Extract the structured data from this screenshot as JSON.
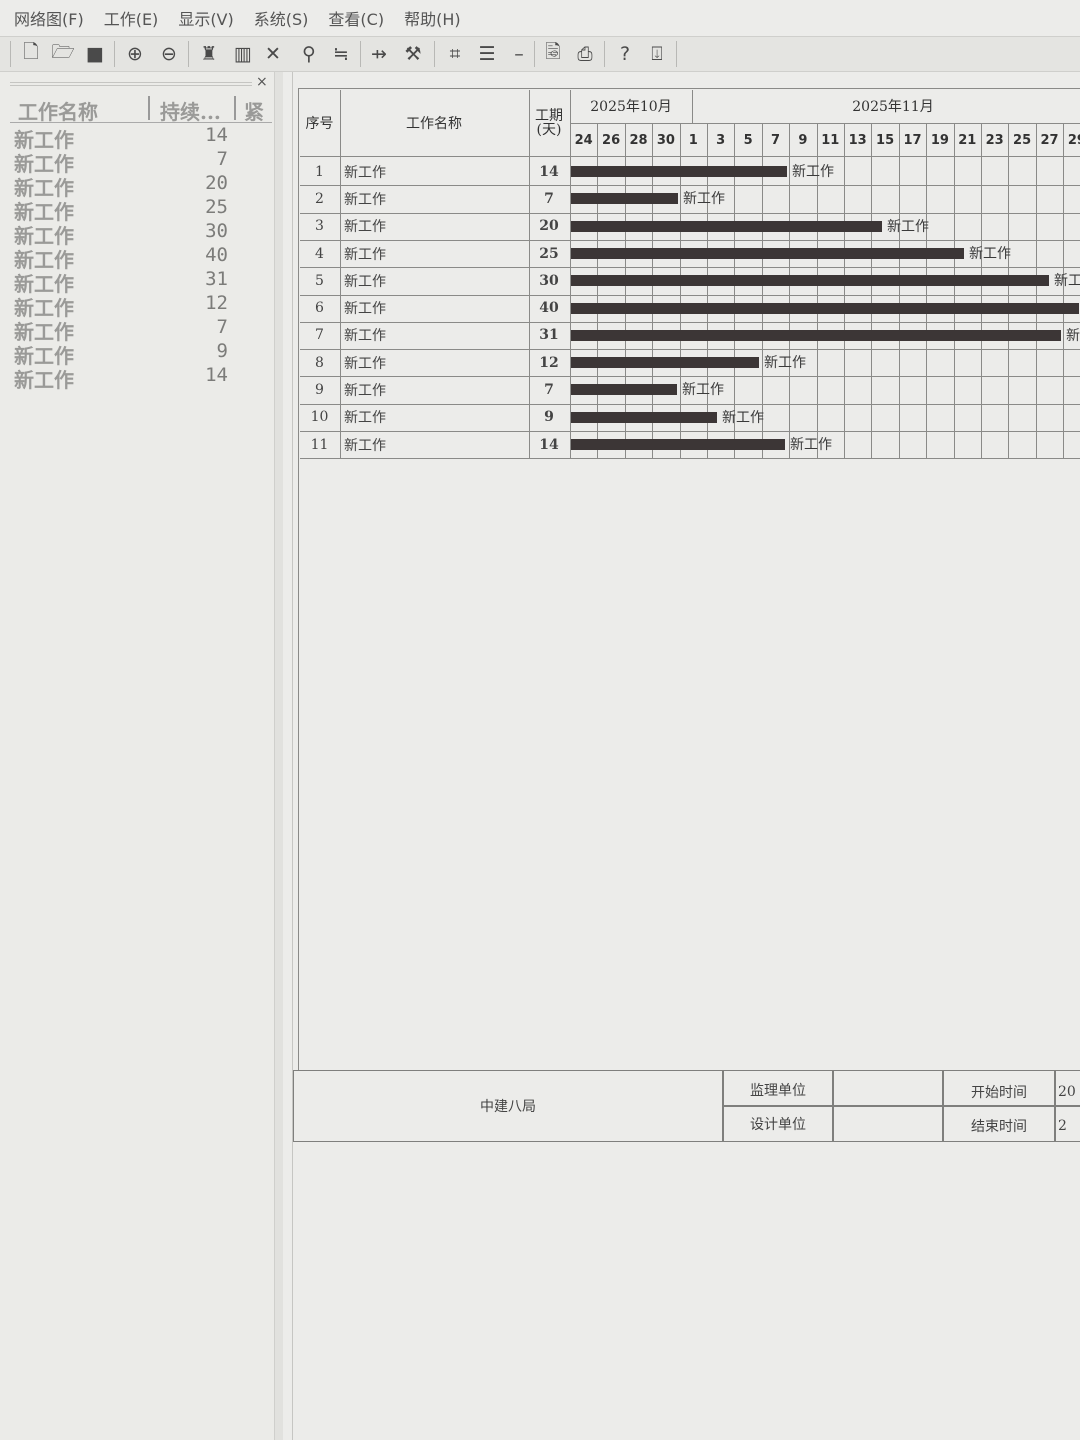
{
  "menu": [
    "网络图(F)",
    "工作(E)",
    "显示(V)",
    "系统(S)",
    "查看(C)",
    "帮助(H)"
  ],
  "toolbar": {
    "icons": [
      "new-file-icon",
      "open-folder-icon",
      "save-icon",
      "zoom-in-icon",
      "zoom-out-icon",
      "print-preview-icon",
      "chart-icon",
      "delete-icon",
      "find-icon",
      "filter-icon",
      "add-link-icon",
      "tools-icon",
      "network-icon",
      "gantt-icon",
      "minus-icon",
      "page-preview-icon",
      "printer-icon",
      "help-icon",
      "exit-icon"
    ]
  },
  "sidebar": {
    "close": "×",
    "headers": [
      "工作名称",
      "持续...",
      "紧"
    ],
    "rows": [
      {
        "name": "新工作",
        "duration": "14"
      },
      {
        "name": "新工作",
        "duration": "7"
      },
      {
        "name": "新工作",
        "duration": "20"
      },
      {
        "name": "新工作",
        "duration": "25"
      },
      {
        "name": "新工作",
        "duration": "30"
      },
      {
        "name": "新工作",
        "duration": "40"
      },
      {
        "name": "新工作",
        "duration": "31"
      },
      {
        "name": "新工作",
        "duration": "12"
      },
      {
        "name": "新工作",
        "duration": "7"
      },
      {
        "name": "新工作",
        "duration": "9"
      },
      {
        "name": "新工作",
        "duration": "14"
      }
    ]
  },
  "gantt": {
    "headers": {
      "seq": "序号",
      "name": "工作名称",
      "duration": "工期\n(天)"
    },
    "months": [
      "2025年10月",
      "2025年11月"
    ],
    "days": [
      "24",
      "26",
      "28",
      "30",
      "1",
      "3",
      "5",
      "7",
      "9",
      "11",
      "13",
      "15",
      "17",
      "19",
      "21",
      "23",
      "25",
      "27",
      "29"
    ],
    "rows": [
      {
        "seq": "1",
        "name": "新工作",
        "duration": "14",
        "bar_label": "新工作"
      },
      {
        "seq": "2",
        "name": "新工作",
        "duration": "7",
        "bar_label": "新工作"
      },
      {
        "seq": "3",
        "name": "新工作",
        "duration": "20",
        "bar_label": "新工作"
      },
      {
        "seq": "4",
        "name": "新工作",
        "duration": "25",
        "bar_label": "新工作"
      },
      {
        "seq": "5",
        "name": "新工作",
        "duration": "30",
        "bar_label": "新工"
      },
      {
        "seq": "6",
        "name": "新工作",
        "duration": "40",
        "bar_label": ""
      },
      {
        "seq": "7",
        "name": "新工作",
        "duration": "31",
        "bar_label": "新"
      },
      {
        "seq": "8",
        "name": "新工作",
        "duration": "12",
        "bar_label": "新工作"
      },
      {
        "seq": "9",
        "name": "新工作",
        "duration": "7",
        "bar_label": "新工作"
      },
      {
        "seq": "10",
        "name": "新工作",
        "duration": "9",
        "bar_label": "新工作"
      },
      {
        "seq": "11",
        "name": "新工作",
        "duration": "14",
        "bar_label": "新工作"
      }
    ]
  },
  "footer": {
    "company": "中建八局",
    "supervisor_label": "监理单位",
    "design_label": "设计单位",
    "start_label": "开始时间",
    "end_label": "结束时间",
    "start_value": "20",
    "end_value": "2"
  }
}
